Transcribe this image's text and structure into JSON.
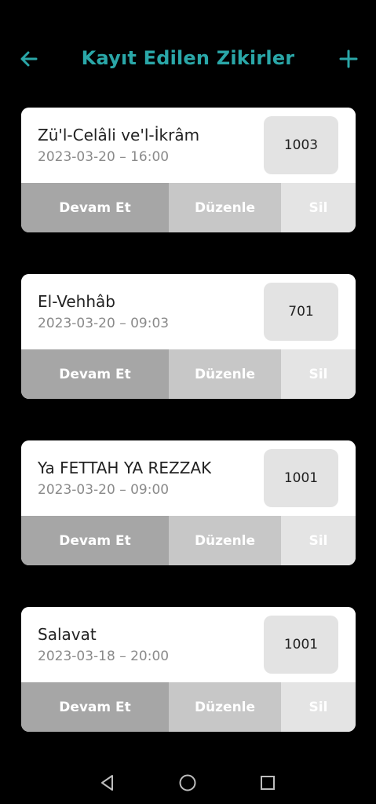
{
  "header": {
    "title": "Kayıt Edilen Zikirler",
    "back_icon": "arrow-left-icon",
    "add_icon": "plus-icon",
    "accent_color": "#2aa7a8"
  },
  "items": [
    {
      "name": "Zü'l-Celâli ve'l-İkrâm",
      "date": "2023-03-20 – 16:00",
      "count": "1003",
      "actions": {
        "continue": "Devam Et",
        "edit": "Düzenle",
        "delete": "Sil"
      }
    },
    {
      "name": "El-Vehhâb",
      "date": "2023-03-20 – 09:03",
      "count": "701",
      "actions": {
        "continue": "Devam Et",
        "edit": "Düzenle",
        "delete": "Sil"
      }
    },
    {
      "name": "Ya FETTAH YA REZZAK",
      "date": "2023-03-20 – 09:00",
      "count": "1001",
      "actions": {
        "continue": "Devam Et",
        "edit": "Düzenle",
        "delete": "Sil"
      }
    },
    {
      "name": "Salavat",
      "date": "2023-03-18 – 20:00",
      "count": "1001",
      "actions": {
        "continue": "Devam Et",
        "edit": "Düzenle",
        "delete": "Sil"
      }
    }
  ],
  "navbar": {
    "back_icon": "triangle-back-icon",
    "home_icon": "circle-home-icon",
    "recents_icon": "square-recents-icon"
  }
}
